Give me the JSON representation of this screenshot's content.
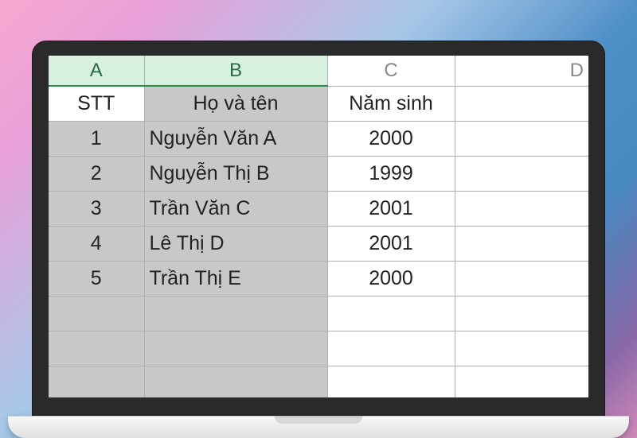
{
  "columns": {
    "a": "A",
    "b": "B",
    "c": "C",
    "d": "D"
  },
  "headers": {
    "stt": "STT",
    "name": "Họ và tên",
    "year": "Năm sinh"
  },
  "rows": [
    {
      "stt": "1",
      "name": "Nguyễn Văn A",
      "year": "2000"
    },
    {
      "stt": "2",
      "name": "Nguyễn Thị B",
      "year": "1999"
    },
    {
      "stt": "3",
      "name": "Trần Văn C",
      "year": "2001"
    },
    {
      "stt": "4",
      "name": "Lê Thị D",
      "year": "2001"
    },
    {
      "stt": "5",
      "name": "Trần Thị E",
      "year": "2000"
    }
  ]
}
